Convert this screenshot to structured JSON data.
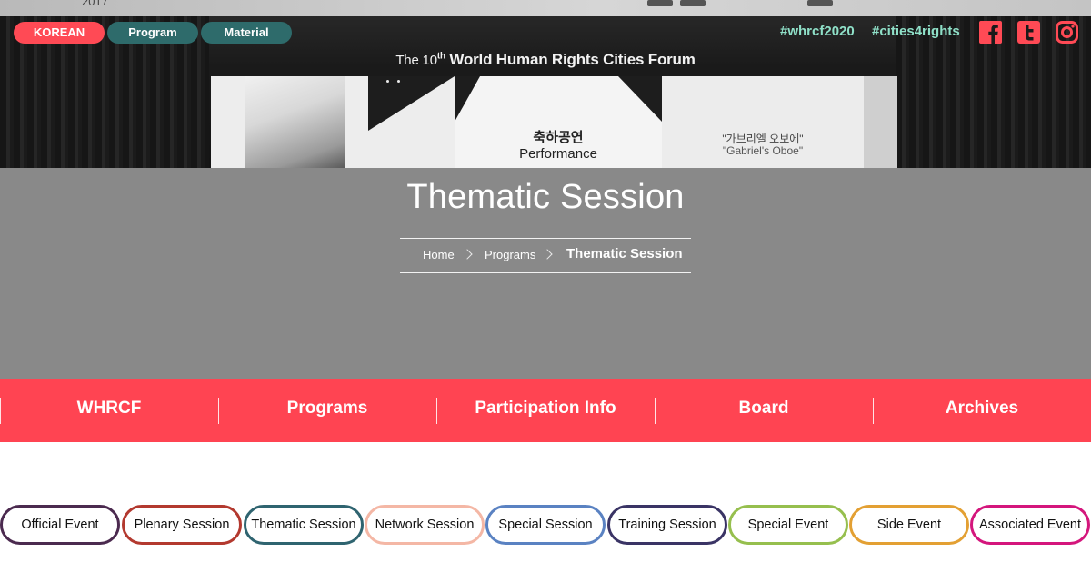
{
  "hero": {
    "year_fragment": "2017",
    "stage_title_pre": "The 10",
    "stage_title_sup": "th",
    "stage_title_main": "World Human Rights Cities Forum",
    "screen_center_kr": "축하공연",
    "screen_center_en": "Performance",
    "screen_right_kr": "\"가브리엘 오보에\"",
    "screen_right_en": "\"Gabriel's Oboe\""
  },
  "topbar": {
    "korean_label": "KOREAN",
    "program_label": "Program",
    "material_label": "Material",
    "hashtag1": "#whrcf2020",
    "hashtag2": "#cities4rights",
    "social_icons": [
      "facebook-icon",
      "twitter-icon",
      "instagram-icon"
    ]
  },
  "page": {
    "title": "Thematic Session"
  },
  "breadcrumb": {
    "home": "Home",
    "programs": "Programs",
    "current": "Thematic Session"
  },
  "mainnav": {
    "items": [
      "WHRCF",
      "Programs",
      "Participation Info",
      "Board",
      "Archives"
    ]
  },
  "category_tabs": [
    {
      "label": "Official Event",
      "color": "#4b2a4f"
    },
    {
      "label": "Plenary Session",
      "color": "#b3392f"
    },
    {
      "label": "Thematic Session",
      "color": "#2f6470"
    },
    {
      "label": "Network Session",
      "color": "#f4b7a5"
    },
    {
      "label": "Special Session",
      "color": "#5a82c2"
    },
    {
      "label": "Training Session",
      "color": "#3a3465"
    },
    {
      "label": "Special Event",
      "color": "#96bf4e"
    },
    {
      "label": "Side Event",
      "color": "#e3a033"
    },
    {
      "label": "Associated Event",
      "color": "#d4167c"
    }
  ],
  "colors": {
    "accent_red": "#ff4452",
    "teal": "#2e6b6b",
    "hashtag": "#8fe0c8",
    "band_gray": "#898989"
  }
}
